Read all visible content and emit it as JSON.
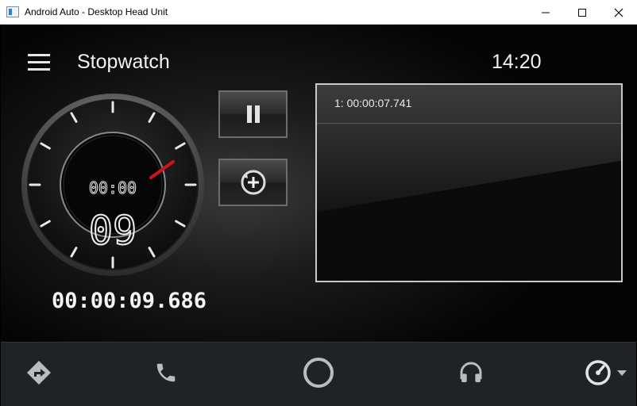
{
  "window": {
    "title": "Android Auto - Desktop Head Unit",
    "controls": [
      "minimize",
      "maximize",
      "close"
    ]
  },
  "appbar": {
    "title": "Stopwatch",
    "time": "14:20",
    "menu_icon": "hamburger-menu-icon"
  },
  "stopwatch": {
    "dial_small": "00:00",
    "dial_seconds": "09",
    "elapsed": "00:00:09.686"
  },
  "controls": {
    "pause_icon": "pause-icon",
    "lap_icon": "add-lap-icon"
  },
  "laps": [
    {
      "text": "1: 00:00:07.741"
    }
  ],
  "nav": {
    "items": [
      "navigation-icon",
      "phone-icon",
      "home-circle-icon",
      "headphones-icon",
      "dashboard-icon"
    ],
    "dropdown_icon": "caret-down-icon"
  },
  "colors": {
    "accent_red": "#d0141a",
    "nav_bg": "#1e2327",
    "icon_gray": "#b8bdc0"
  }
}
